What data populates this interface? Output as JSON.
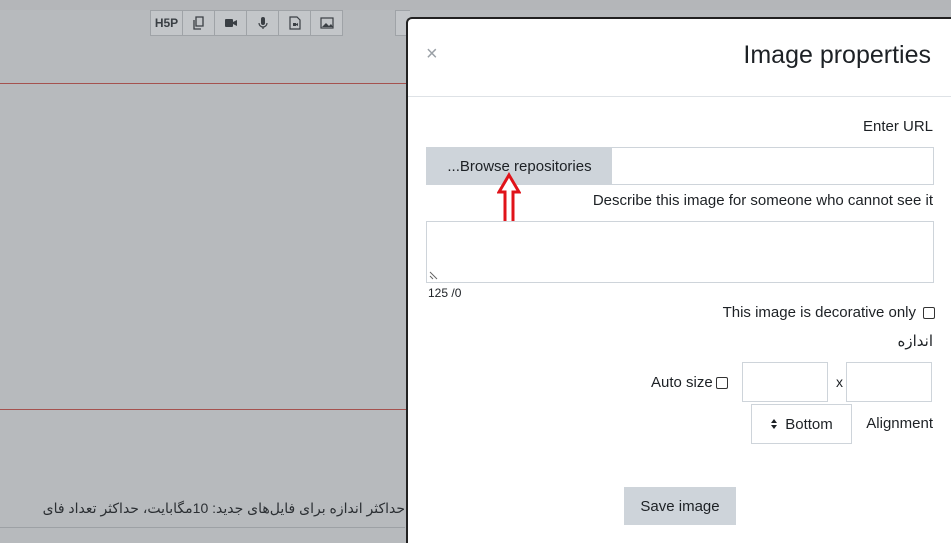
{
  "editor": {
    "toolbar_items": [
      {
        "label": "H5P",
        "icon": "h5p-icon"
      },
      {
        "label": "",
        "icon": "copy-icon"
      },
      {
        "label": "",
        "icon": "video-icon"
      },
      {
        "label": "",
        "icon": "microphone-icon"
      },
      {
        "label": "",
        "icon": "media-file-icon"
      },
      {
        "label": "",
        "icon": "image-icon"
      }
    ],
    "footer_text": "حداکثر اندازه برای فایل‌های جدید: 10مگابایت، حداکثر تعداد فای"
  },
  "modal": {
    "title": "Image properties",
    "close_label": "×",
    "url_label": "Enter URL",
    "browse_label": "...Browse repositories",
    "url_value": "",
    "alt_label": "Describe this image for someone who cannot see it",
    "alt_value": "",
    "counter": "125 /0",
    "decorative_label": "This image is decorative only",
    "decorative_checked": false,
    "size_label": "اندازه",
    "autosize_label": "Auto size",
    "autosize_checked": false,
    "width_value": "",
    "height_value": "",
    "size_separator": "x",
    "alignment_label": "Alignment",
    "alignment_value": "Bottom",
    "save_label": "Save image"
  },
  "colors": {
    "overlay": "#b7babd",
    "modal_bg": "#ffffff",
    "button_bg": "#ced4da",
    "arrow": "#e0131a",
    "editor_line": "#a5524f"
  }
}
